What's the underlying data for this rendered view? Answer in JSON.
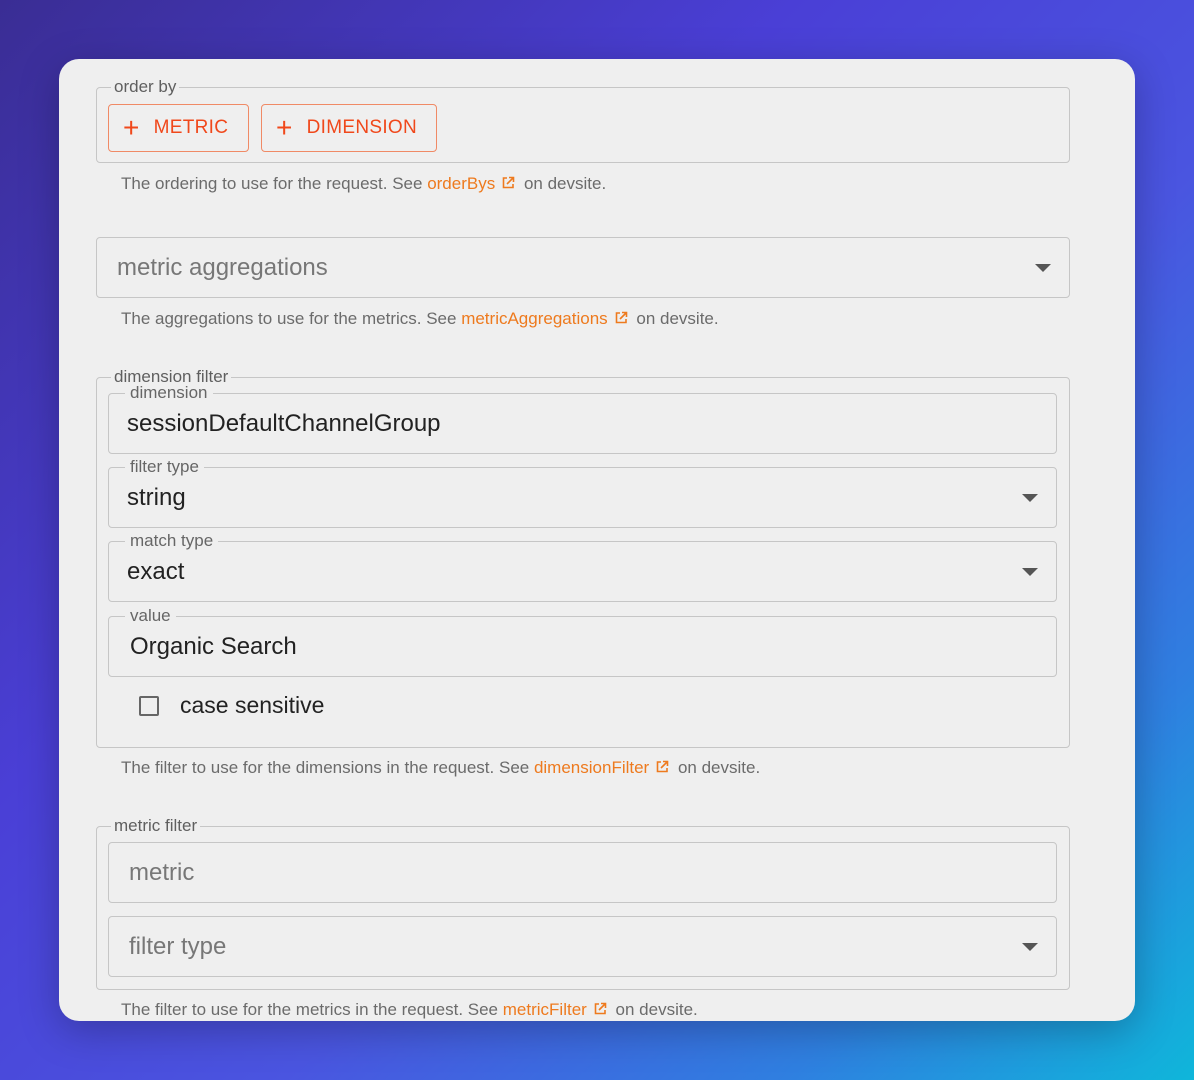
{
  "order_by": {
    "legend": "order by",
    "buttons": [
      {
        "label": "METRIC"
      },
      {
        "label": "DIMENSION"
      }
    ],
    "help_prefix": "The ordering to use for the request. See ",
    "help_link": "orderBys",
    "help_suffix": " on devsite."
  },
  "metric_aggregations": {
    "placeholder": "metric aggregations",
    "help_prefix": "The aggregations to use for the metrics. See ",
    "help_link": "metricAggregations",
    "help_suffix": " on devsite."
  },
  "dimension_filter": {
    "legend": "dimension filter",
    "dimension": {
      "label": "dimension",
      "value": "sessionDefaultChannelGroup"
    },
    "filter_type": {
      "label": "filter type",
      "value": "string"
    },
    "match_type": {
      "label": "match type",
      "value": "exact"
    },
    "value": {
      "label": "value",
      "value": "Organic Search"
    },
    "case_sensitive": {
      "label": "case sensitive",
      "checked": false
    },
    "help_prefix": "The filter to use for the dimensions in the request. See ",
    "help_link": "dimensionFilter",
    "help_suffix": " on devsite."
  },
  "metric_filter": {
    "legend": "metric filter",
    "metric_placeholder": "metric",
    "filter_type_placeholder": "filter type",
    "help_prefix": "The filter to use for the metrics in the request. See ",
    "help_link": "metricFilter",
    "help_suffix": " on devsite."
  },
  "colors": {
    "accent": "#f0481b",
    "link": "#ee7a1e",
    "card": "#efefef"
  },
  "icons": {
    "add": "plus-icon",
    "external": "external-link-icon",
    "dropdown": "caret-down-icon",
    "checkbox": "checkbox-unchecked-icon"
  }
}
